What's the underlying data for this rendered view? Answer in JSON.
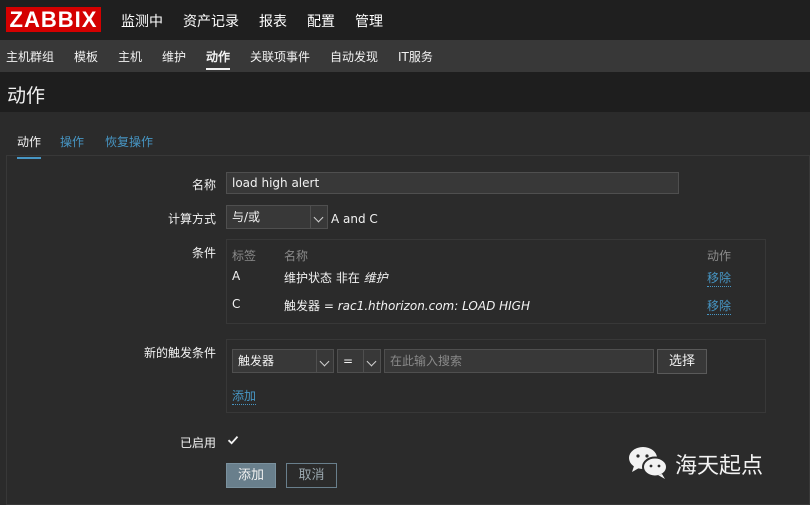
{
  "brand": {
    "logo": "ZABBIX",
    "accent": "#d40000",
    "link_color": "#4796c4"
  },
  "top_nav": [
    "监测中",
    "资产记录",
    "报表",
    "配置",
    "管理"
  ],
  "sub_nav": [
    "主机群组",
    "模板",
    "主机",
    "维护",
    "动作",
    "关联项事件",
    "自动发现",
    "IT服务"
  ],
  "sub_nav_active": "动作",
  "page_title": "动作",
  "tabs": [
    "动作",
    "操作",
    "恢复操作"
  ],
  "form": {
    "name_label": "名称",
    "name_value": "load high alert",
    "calc_label": "计算方式",
    "calc_value": "与/或",
    "calc_expr": "A and C",
    "conditions_label": "条件",
    "conditions_headers": {
      "tag": "标签",
      "name": "名称",
      "action": "动作"
    },
    "conditions": [
      {
        "tag": "A",
        "name_prefix": "维护状态 非在 ",
        "name_value": "维护",
        "action": "移除"
      },
      {
        "tag": "C",
        "name_prefix": "触发器 = ",
        "name_value": "rac1.hthorizon.com: LOAD HIGH",
        "action": "移除"
      }
    ],
    "new_condition_label": "新的触发条件",
    "new_condition_type": "触发器",
    "new_condition_operator": "=",
    "search_placeholder": "在此输入搜索",
    "select_button": "选择",
    "add_link": "添加",
    "enabled_label": "已启用",
    "enabled": true,
    "add_button": "添加",
    "cancel_button": "取消"
  },
  "watermark": {
    "icon": "wechat-icon",
    "text": "海天起点"
  }
}
